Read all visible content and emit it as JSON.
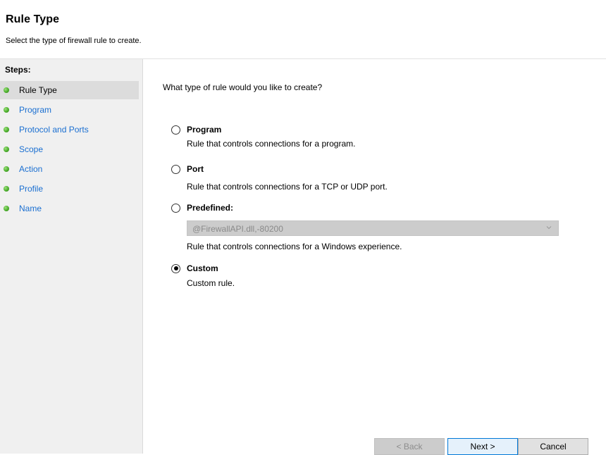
{
  "header": {
    "title": "Rule Type",
    "subtitle": "Select the type of firewall rule to create."
  },
  "sidebar": {
    "heading": "Steps:",
    "steps": [
      {
        "label": "Rule Type",
        "active": true
      },
      {
        "label": "Program"
      },
      {
        "label": "Protocol and Ports"
      },
      {
        "label": "Scope"
      },
      {
        "label": "Action"
      },
      {
        "label": "Profile"
      },
      {
        "label": "Name"
      }
    ]
  },
  "main": {
    "question": "What type of rule would you like to create?",
    "options": [
      {
        "label": "Program",
        "description": "Rule that controls connections for a program.",
        "selected": false
      },
      {
        "label": "Port",
        "description": "Rule that controls connections for a TCP or UDP port.",
        "selected": false
      },
      {
        "label": "Predefined:",
        "description": "Rule that controls connections for a Windows experience.",
        "selected": false
      },
      {
        "label": "Custom",
        "description": "Custom rule.",
        "selected": true
      }
    ],
    "predefined_select": {
      "value": "@FirewallAPI.dll,-80200",
      "enabled": false
    }
  },
  "buttons": {
    "back": "< Back",
    "next": "Next >",
    "cancel": "Cancel"
  },
  "colors": {
    "link": "#1a6fd1",
    "step_dot": "#4caf2c",
    "sidebar_bg": "#f0f0f0",
    "primary_border": "#0078d7"
  },
  "icons": {
    "step_bullet": "green-dot-icon",
    "combo_arrow": "chevron-down-icon"
  }
}
